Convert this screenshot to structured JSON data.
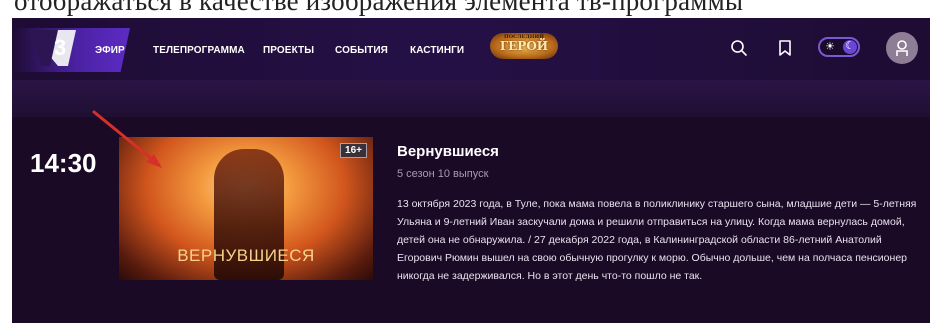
{
  "caption": "отображаться в качестве изображения элемента тв-программы",
  "nav": {
    "logo": "3",
    "items": [
      "ЭФИР",
      "ТЕЛЕПРОГРАММА",
      "ПРОЕКТЫ",
      "СОБЫТИЯ",
      "КАСТИНГИ"
    ],
    "badge": {
      "top": "ПОСЛЕДНИЙ",
      "main": "ГЕРОЙ"
    },
    "icons": [
      "search-icon",
      "bookmark-icon",
      "theme-toggle",
      "user-icon"
    ]
  },
  "program": {
    "time": "14:30",
    "thumbnail_title": "ВЕРНУВШИЕСЯ",
    "age_rating": "16+",
    "title": "Вернувшиеся",
    "episode": "5 сезон 10 выпуск",
    "description": "13 октября 2023 года, в Туле, пока мама повела в поликлинику старшего сына, младшие дети — 5-летняя Ульяна и 9-летний Иван заскучали дома и решили отправиться на улицу. Когда мама вернулась домой, детей она не обнаружила. / 27 декабря 2022 года, в Калининградской области 86-летний Анатолий Егорович Рюмин вышел на свою обычную прогулку к морю. Обычно дольше, чем на полчаса пенсионер никогда не задерживался. Но в этот день что-то пошло не так."
  },
  "colors": {
    "accent": "#6b45d6",
    "background": "#1a0a26",
    "annotation_arrow": "#d6302a"
  }
}
